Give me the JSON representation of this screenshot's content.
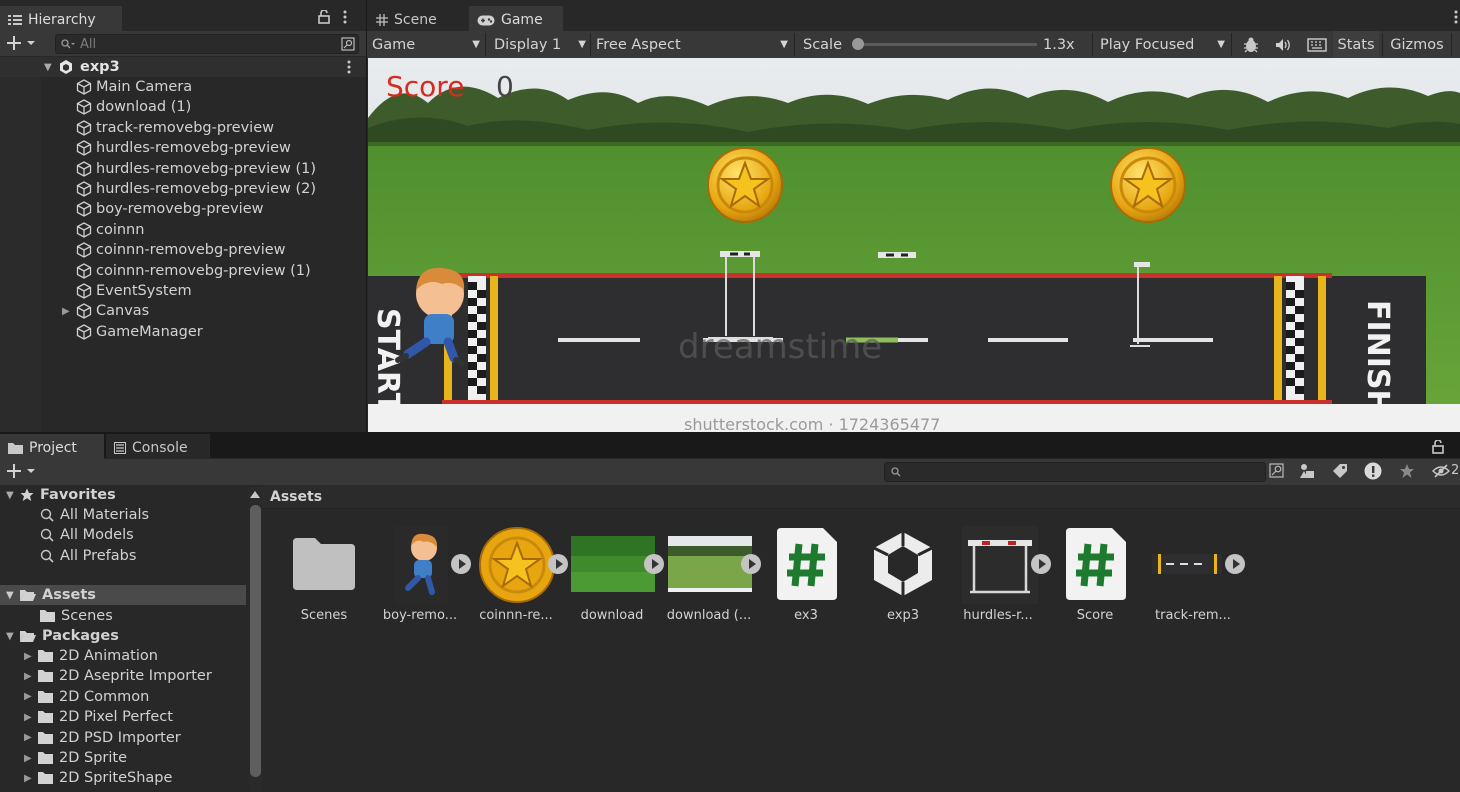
{
  "hierarchy": {
    "tab_label": "Hierarchy",
    "search_placeholder": "All",
    "scene_name": "exp3",
    "items": [
      {
        "label": "Main Camera",
        "expandable": false
      },
      {
        "label": "download (1)",
        "expandable": false
      },
      {
        "label": "track-removebg-preview",
        "expandable": false
      },
      {
        "label": "hurdles-removebg-preview",
        "expandable": false
      },
      {
        "label": "hurdles-removebg-preview (1)",
        "expandable": false
      },
      {
        "label": "hurdles-removebg-preview (2)",
        "expandable": false
      },
      {
        "label": "boy-removebg-preview",
        "expandable": false
      },
      {
        "label": "coinnn",
        "expandable": false
      },
      {
        "label": "coinnn-removebg-preview",
        "expandable": false
      },
      {
        "label": "coinnn-removebg-preview (1)",
        "expandable": false
      },
      {
        "label": "EventSystem",
        "expandable": false
      },
      {
        "label": "Canvas",
        "expandable": true
      },
      {
        "label": "GameManager",
        "expandable": false
      }
    ]
  },
  "view_tabs": {
    "scene": "Scene",
    "game": "Game"
  },
  "game_toolbar": {
    "mode": "Game",
    "display": "Display 1",
    "aspect": "Free Aspect",
    "scale_label": "Scale",
    "scale_value": "1.3x",
    "scale_fraction": 0.0,
    "play_mode": "Play Focused",
    "stats": "Stats",
    "gizmos": "Gizmos"
  },
  "game": {
    "score_label": "Score",
    "score_value": "0",
    "track_start": "START",
    "track_finish": "FINISH",
    "watermark": "dreamstime",
    "footer_text": "shutterstock.com · 1724365477"
  },
  "bottom_tabs": {
    "project": "Project",
    "console": "Console"
  },
  "project": {
    "favorites_label": "Favorites",
    "favorites": [
      "All Materials",
      "All Models",
      "All Prefabs"
    ],
    "assets_label": "Assets",
    "assets_children": [
      "Scenes"
    ],
    "packages_label": "Packages",
    "packages": [
      "2D Animation",
      "2D Aseprite Importer",
      "2D Common",
      "2D Pixel Perfect",
      "2D PSD Importer",
      "2D Sprite",
      "2D SpriteShape"
    ],
    "breadcrumb": "Assets",
    "hidden_count": "2",
    "asset_items": [
      {
        "label": "Scenes",
        "kind": "folder-icon"
      },
      {
        "label": "boy-remo...",
        "kind": "sprite-boy"
      },
      {
        "label": "coinnn-re...",
        "kind": "sprite-coin"
      },
      {
        "label": "download",
        "kind": "texture-grass"
      },
      {
        "label": "download (...",
        "kind": "texture-field"
      },
      {
        "label": "ex3",
        "kind": "csharp-script-icon"
      },
      {
        "label": "exp3",
        "kind": "unity-scene-icon"
      },
      {
        "label": "hurdles-r...",
        "kind": "sprite-hurdle"
      },
      {
        "label": "Score",
        "kind": "csharp-script-icon"
      },
      {
        "label": "track-rem...",
        "kind": "sprite-track"
      }
    ]
  }
}
